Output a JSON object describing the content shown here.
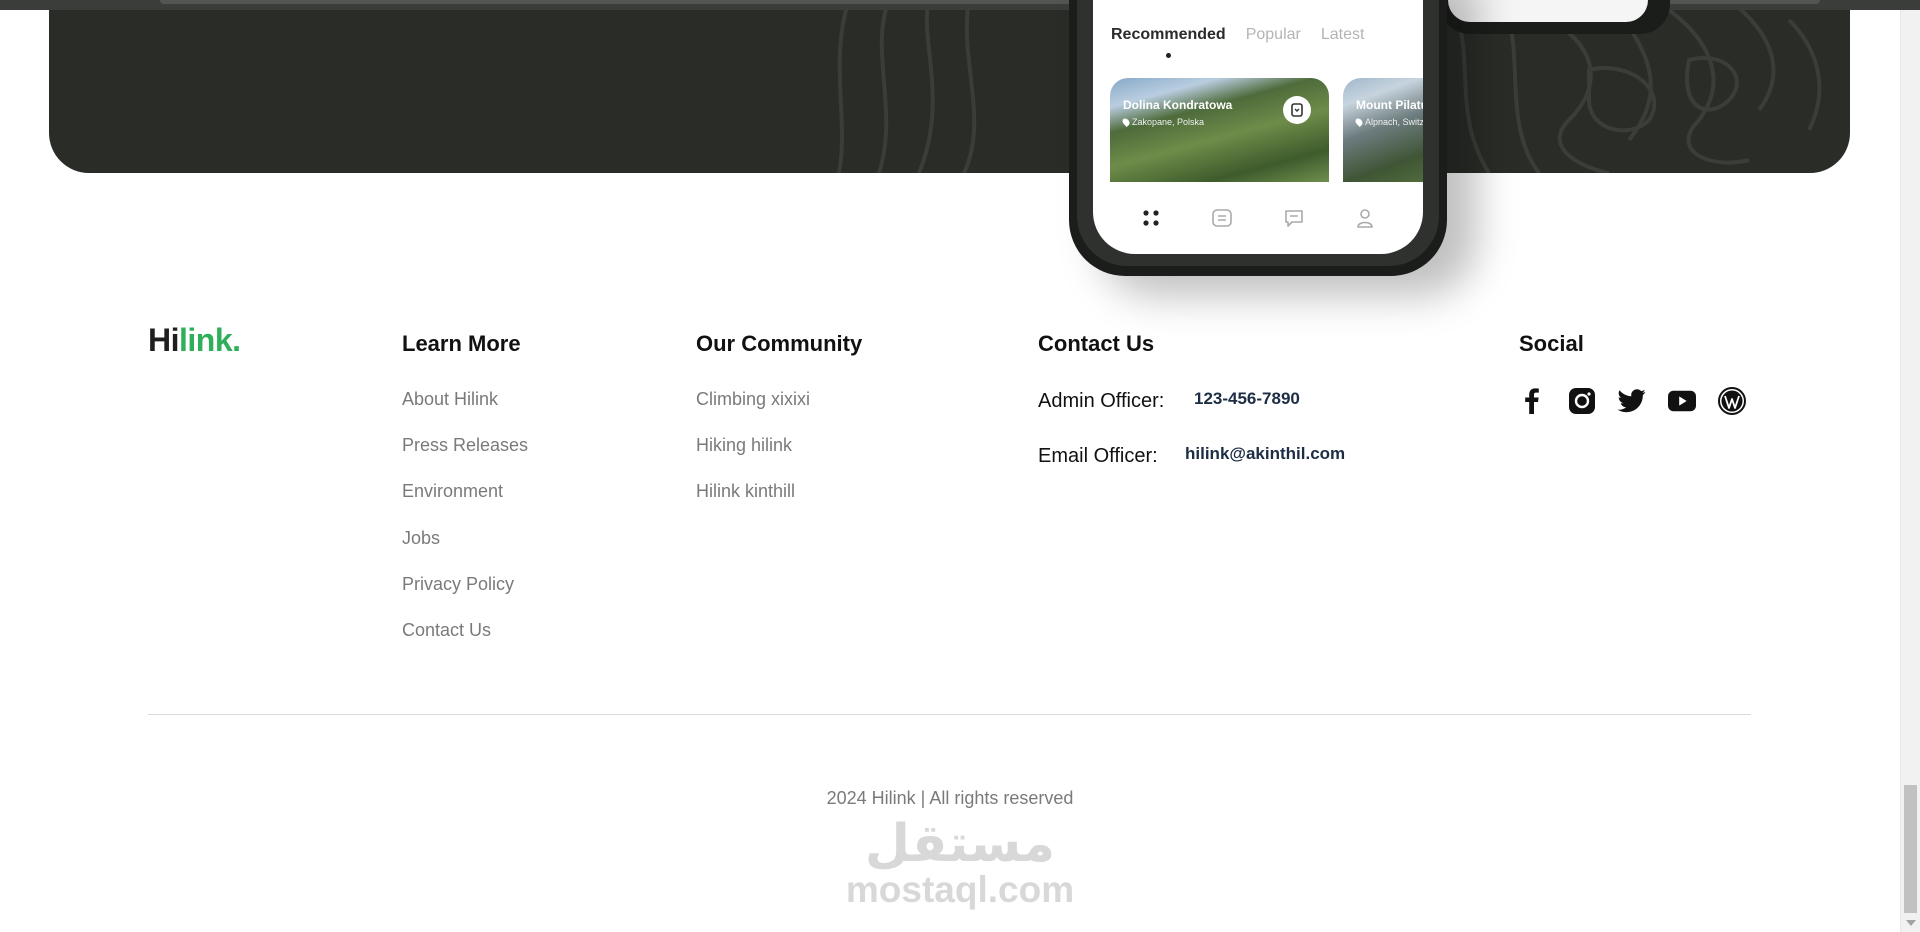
{
  "phone": {
    "tabs": [
      "Recommended",
      "Popular",
      "Latest"
    ],
    "cards": [
      {
        "title": "Dolina Kondratowa",
        "location": "Zakopane, Polska"
      },
      {
        "title": "Mount Pilatu",
        "location": "Alpnach, Switze"
      }
    ],
    "nav_icons": [
      "grid-icon",
      "list-icon",
      "chat-icon",
      "profile-icon"
    ]
  },
  "logo": {
    "part1": "Hi",
    "part2": "link.",
    "accent": "#30af5b"
  },
  "learn_more": {
    "title": "Learn More",
    "links": [
      "About Hilink",
      "Press Releases",
      "Environment",
      "Jobs",
      "Privacy Policy",
      "Contact Us"
    ]
  },
  "community": {
    "title": "Our Community",
    "links": [
      "Climbing xixixi",
      "Hiking hilink",
      "Hilink kinthill"
    ]
  },
  "contact": {
    "title": "Contact Us",
    "admin_label": "Admin Officer:",
    "admin_value": "123-456-7890",
    "email_label": "Email Officer:",
    "email_value": "hilink@akinthil.com"
  },
  "social": {
    "title": "Social",
    "icons": [
      "facebook-icon",
      "instagram-icon",
      "twitter-icon",
      "youtube-icon",
      "wordpress-icon"
    ]
  },
  "copyright": "2024 Hilink | All rights reserved",
  "watermark": {
    "arabic": "مستقل",
    "latin": "mostaql.com"
  }
}
